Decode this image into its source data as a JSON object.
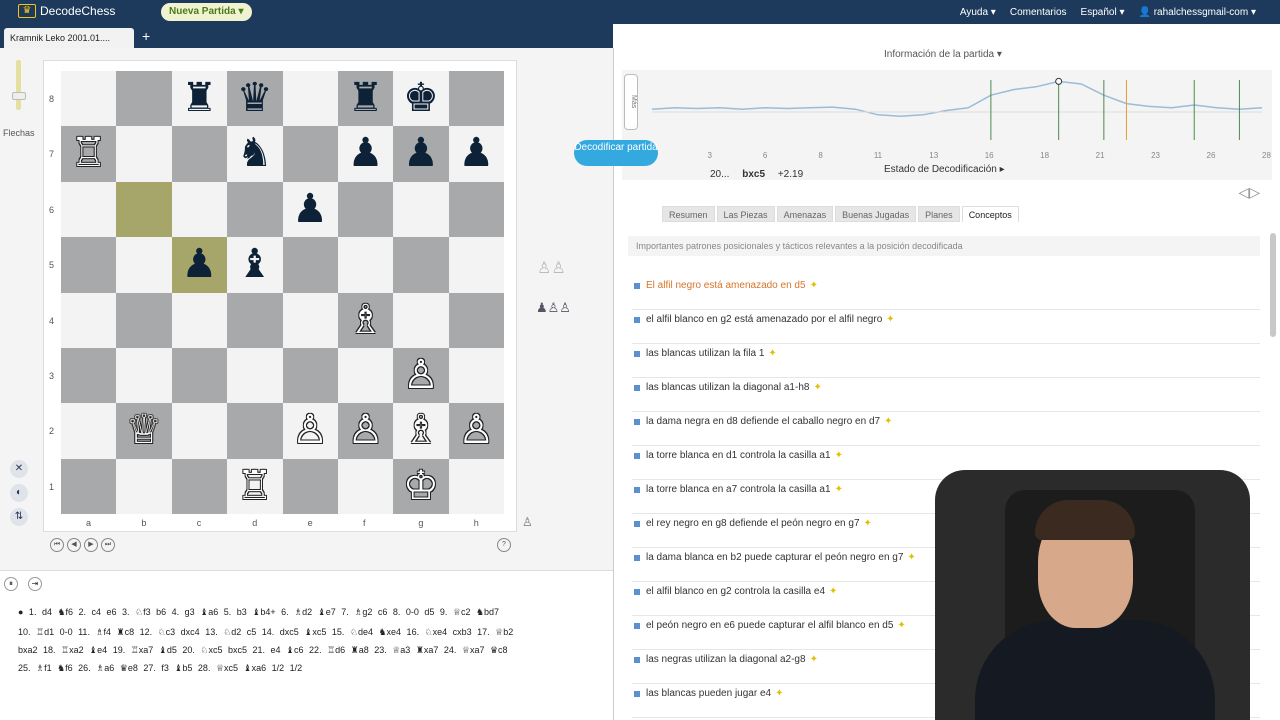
{
  "app": {
    "logo_text": "DecodeChess",
    "new_game": "Nueva Partida ▾"
  },
  "menu": [
    "Ayuda ▾",
    "Comentarios",
    "Español ▾",
    "👤 rahalchessgmail-com ▾"
  ],
  "tab_title": "Kramnik Leko 2001.01....",
  "board": {
    "side_label": "Flechas",
    "ranks": [
      "8",
      "7",
      "6",
      "5",
      "4",
      "3",
      "2",
      "1"
    ],
    "files": [
      "a",
      "b",
      "c",
      "d",
      "e",
      "f",
      "g",
      "h"
    ],
    "highlight": [
      "b6",
      "c5"
    ],
    "pieces": [
      {
        "sq": "c8",
        "p": "♜",
        "c": "b"
      },
      {
        "sq": "d8",
        "p": "♛",
        "c": "b"
      },
      {
        "sq": "f8",
        "p": "♜",
        "c": "b"
      },
      {
        "sq": "g8",
        "p": "♚",
        "c": "b"
      },
      {
        "sq": "a7",
        "p": "♖",
        "c": "w"
      },
      {
        "sq": "d7",
        "p": "♞",
        "c": "b"
      },
      {
        "sq": "f7",
        "p": "♟",
        "c": "b"
      },
      {
        "sq": "g7",
        "p": "♟",
        "c": "b"
      },
      {
        "sq": "h7",
        "p": "♟",
        "c": "b"
      },
      {
        "sq": "e6",
        "p": "♟",
        "c": "b"
      },
      {
        "sq": "c5",
        "p": "♟",
        "c": "b"
      },
      {
        "sq": "d5",
        "p": "♝",
        "c": "b"
      },
      {
        "sq": "f4",
        "p": "♗",
        "c": "w"
      },
      {
        "sq": "g3",
        "p": "♙",
        "c": "w"
      },
      {
        "sq": "b2",
        "p": "♕",
        "c": "w"
      },
      {
        "sq": "e2",
        "p": "♙",
        "c": "w"
      },
      {
        "sq": "f2",
        "p": "♙",
        "c": "w"
      },
      {
        "sq": "g2",
        "p": "♗",
        "c": "w"
      },
      {
        "sq": "h2",
        "p": "♙",
        "c": "w"
      },
      {
        "sq": "d1",
        "p": "♖",
        "c": "w"
      },
      {
        "sq": "g1",
        "p": "♔",
        "c": "w"
      }
    ]
  },
  "moves": [
    "● 1. d4 ♞f6 2. c4 e6 3. ♘f3 b6 4. g3 ♝a6 5. b3 ♝b4+ 6. ♗d2 ♝e7 7. ♗g2 c6 8. 0-0 d5 9. ♕c2 ♞bd7",
    "10. ♖d1 0-0 11. ♗f4 ♜c8 12. ♘c3 dxc4 13. ♘d2 c5 14. dxc5 ♝xc5 15. ♘de4 ♞xe4 16. ♘xe4 cxb3 17. ♕b2",
    "bxa2 18. ♖xa2 ♝e4 19. ♖xa7 ♝d5 20. ♘xc5 bxc5 21. e4 ♝c6 22. ♖d6 ♜a8 23. ♕a3 ♜xa7 24. ♕xa7 ♛c8",
    "25. ♗f1 ♞f6 26. ♗a6 ♛e8 27. f3 ♝b5 28. ♕xc5 ♝xa6 1/2 1/2"
  ],
  "info_header": "Información de la partida ▾",
  "graph": {
    "max_label": "Más",
    "ticks": [
      "1",
      "3",
      "6",
      "8",
      "11",
      "13",
      "16",
      "18",
      "21",
      "23",
      "26",
      "28"
    ],
    "eval": [
      0.2,
      0.3,
      0.25,
      0.3,
      0.2,
      0.3,
      0.25,
      0.3,
      0.35,
      0.2,
      -0.2,
      -0.3,
      -0.2,
      0.1,
      0.3,
      1.2,
      1.6,
      1.8,
      2.19,
      2.0,
      1.2,
      0.6,
      0.4,
      0.3,
      0.5,
      0.3,
      0.2,
      0.3
    ],
    "current": {
      "move": "20...",
      "san": "bxc5",
      "eval": "+2.19"
    }
  },
  "decode_button": "Decodificar partida",
  "estado": "Estado de Decodificación ▸",
  "tabs": [
    "Resumen",
    "Las Piezas",
    "Amenazas",
    "Buenas Jugadas",
    "Planes",
    "Conceptos"
  ],
  "active_tab": "Conceptos",
  "description": "Importantes patrones posicionales y tácticos relevantes a la posición decodificada",
  "concepts": [
    "El alfil negro está amenazado en d5",
    "el alfil blanco en g2 está amenazado por el alfil negro",
    "las blancas utilizan la fila 1",
    "las blancas utilizan la diagonal a1-h8",
    "la dama negra en d8 defiende el caballo negro en d7",
    "la torre blanca en d1 controla la casilla a1",
    "la torre blanca en a7 controla la casilla a1",
    "el rey negro en g8 defiende el peón negro en g7",
    "la dama blanca en b2 puede capturar el peón negro en g7",
    "el alfil blanco en g2 controla la casilla e4",
    "el peón negro en e6 puede capturar el alfil blanco en d5",
    "las negras utilizan la diagonal a2-g8",
    "las blancas pueden jugar e4"
  ]
}
